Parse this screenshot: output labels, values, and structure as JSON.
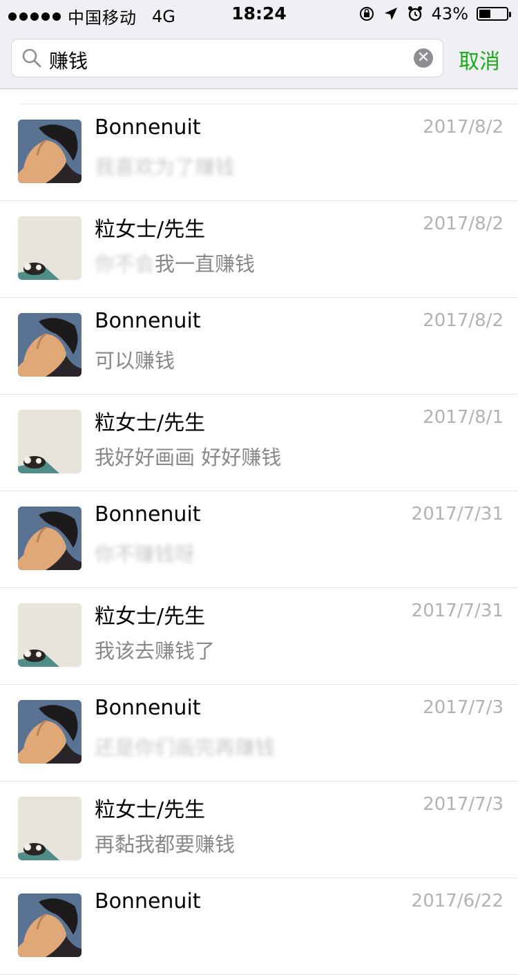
{
  "status": {
    "carrier": "中国移动",
    "network": "4G",
    "time": "18:24",
    "battery": "43%",
    "icons": [
      "orientation-lock-icon",
      "location-icon",
      "alarm-icon",
      "battery-icon"
    ]
  },
  "search": {
    "query": "赚钱",
    "cancel": "取消",
    "icon": "search-icon"
  },
  "results": [
    {
      "name": "Bonnenuit",
      "date": "2017/8/2",
      "blurred": "我喜欢为了赚钱",
      "message": "",
      "avatar": "person"
    },
    {
      "name": "粒女士/先生",
      "date": "2017/8/2",
      "blurred": "你不会",
      "message": "我一直赚钱",
      "avatar": "cat"
    },
    {
      "name": "Bonnenuit",
      "date": "2017/8/2",
      "blurred": "",
      "message": "可以赚钱",
      "avatar": "person"
    },
    {
      "name": "粒女士/先生",
      "date": "2017/8/1",
      "blurred": "",
      "message": "我好好画画 好好赚钱",
      "avatar": "cat"
    },
    {
      "name": "Bonnenuit",
      "date": "2017/7/31",
      "blurred": "你不赚钱呀",
      "message": "",
      "avatar": "person"
    },
    {
      "name": "粒女士/先生",
      "date": "2017/7/31",
      "blurred": "",
      "message": "我该去赚钱了",
      "avatar": "cat"
    },
    {
      "name": "Bonnenuit",
      "date": "2017/7/3",
      "blurred": "还是你们画完再赚钱",
      "message": "",
      "avatar": "person"
    },
    {
      "name": "粒女士/先生",
      "date": "2017/7/3",
      "blurred": "",
      "message": "再黏我都要赚钱",
      "avatar": "cat"
    },
    {
      "name": "Bonnenuit",
      "date": "2017/6/22",
      "blurred": "",
      "message": "",
      "avatar": "person"
    }
  ]
}
